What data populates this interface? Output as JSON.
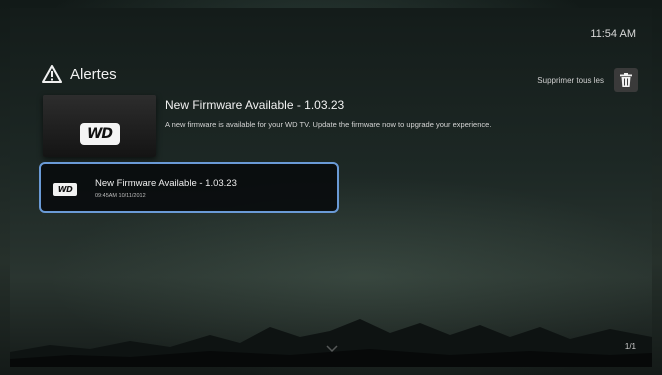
{
  "status_bar": {
    "clock": "11:54 AM"
  },
  "header": {
    "title": "Alertes",
    "icon": "warning-icon"
  },
  "toolbar": {
    "delete_all_label": "Supprimer tous les",
    "delete_icon": "trash-icon"
  },
  "detail": {
    "logo_text": "WD",
    "title": "New Firmware Available - 1.03.23",
    "description": "A new firmware is available for your WD TV. Update the firmware now to upgrade your experience."
  },
  "alerts": [
    {
      "logo_text": "WD",
      "title": "New Firmware Available - 1.03.23",
      "timestamp": "09:45AM 10/11/2012",
      "selected": true
    }
  ],
  "pagination": "1/1",
  "colors": {
    "selection_border": "#6a9ad6",
    "background": "#1d2825"
  }
}
